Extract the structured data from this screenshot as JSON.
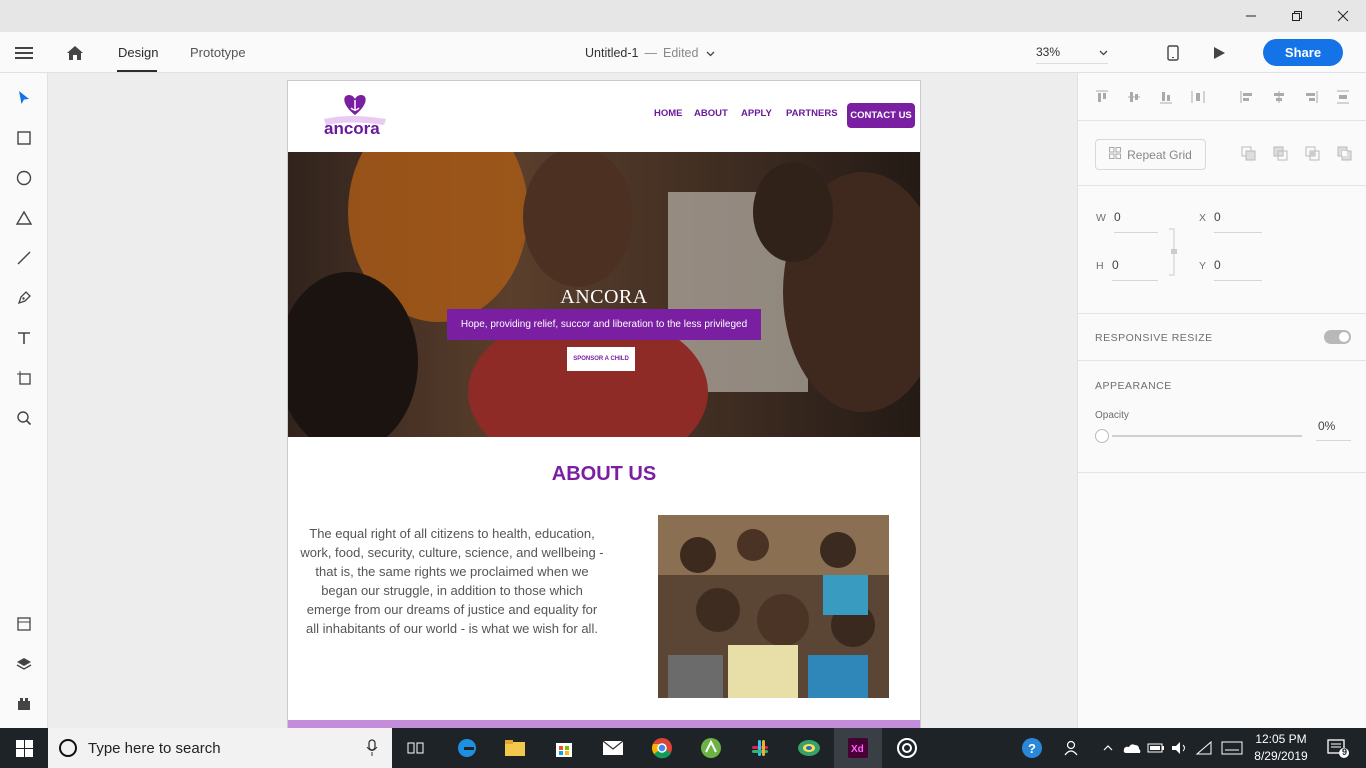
{
  "window": {
    "minimize_icon": "minimize-icon",
    "restore_icon": "restore-icon",
    "close_icon": "close-icon"
  },
  "toolbar": {
    "tab_design": "Design",
    "tab_prototype": "Prototype",
    "doc_title": "Untitled-1",
    "doc_separator": "—",
    "doc_status": "Edited",
    "zoom": "33%",
    "share": "Share"
  },
  "site": {
    "logo_text": "ancora",
    "nav": [
      "HOME",
      "ABOUT",
      "APPLY",
      "PARTNERS"
    ],
    "nav_cta": "CONTACT US",
    "hero_title": "ANCORA",
    "hero_tagline": "Hope, providing relief, succor and liberation to the less privileged",
    "hero_button": "SPONSOR A CHILD",
    "about_title": "ABOUT US",
    "about_text": "The equal right of all citizens to health, education, work, food, security, culture, science, and wellbeing - that is, the same rights we proclaimed when we began our struggle, in addition to those which emerge from our dreams of justice and equality for all inhabitants of our world - is what we wish for all.",
    "brand_color": "#7b1fa2"
  },
  "panel": {
    "repeat_grid": "Repeat Grid",
    "w_label": "W",
    "w_value": "0",
    "x_label": "X",
    "x_value": "0",
    "h_label": "H",
    "h_value": "0",
    "y_label": "Y",
    "y_value": "0",
    "responsive_resize": "RESPONSIVE RESIZE",
    "appearance": "APPEARANCE",
    "opacity_label": "Opacity",
    "opacity_value": "0%"
  },
  "taskbar": {
    "search_placeholder": "Type here to search",
    "time": "12:05 PM",
    "date": "8/29/2019",
    "notification_count": "9"
  }
}
